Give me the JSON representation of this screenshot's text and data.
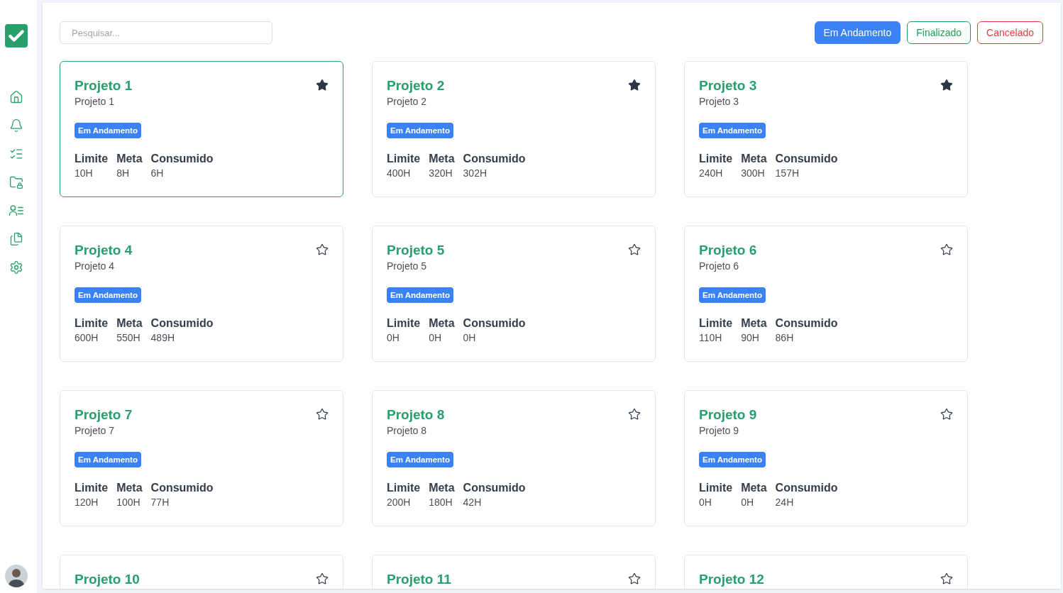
{
  "search": {
    "placeholder": "Pesquisar..."
  },
  "filters": [
    {
      "label": "Em Andamento",
      "kind": "progress",
      "selected": true
    },
    {
      "label": "Finalizado",
      "kind": "done",
      "selected": false
    },
    {
      "label": "Cancelado",
      "kind": "cancelled",
      "selected": false
    }
  ],
  "projects": [
    {
      "title": "Projeto 1",
      "subtitle": "Projeto 1",
      "status": "Em Andamento",
      "favorite": true,
      "selected": true,
      "stats": [
        {
          "label": "Limite",
          "value": "10H"
        },
        {
          "label": "Meta",
          "value": "8H"
        },
        {
          "label": "Consumido",
          "value": "6H"
        }
      ]
    },
    {
      "title": "Projeto 2",
      "subtitle": "Projeto 2",
      "status": "Em Andamento",
      "favorite": true,
      "selected": false,
      "stats": [
        {
          "label": "Limite",
          "value": "400H"
        },
        {
          "label": "Meta",
          "value": "320H"
        },
        {
          "label": "Consumido",
          "value": "302H"
        }
      ]
    },
    {
      "title": "Projeto 3",
      "subtitle": "Projeto 3",
      "status": "Em Andamento",
      "favorite": true,
      "selected": false,
      "stats": [
        {
          "label": "Limite",
          "value": "240H"
        },
        {
          "label": "Meta",
          "value": "300H"
        },
        {
          "label": "Consumido",
          "value": "157H"
        }
      ]
    },
    {
      "title": "Projeto 4",
      "subtitle": "Projeto 4",
      "status": "Em Andamento",
      "favorite": false,
      "selected": false,
      "stats": [
        {
          "label": "Limite",
          "value": "600H"
        },
        {
          "label": "Meta",
          "value": "550H"
        },
        {
          "label": "Consumido",
          "value": "489H"
        }
      ]
    },
    {
      "title": "Projeto 5",
      "subtitle": "Projeto 5",
      "status": "Em Andamento",
      "favorite": false,
      "selected": false,
      "stats": [
        {
          "label": "Limite",
          "value": "0H"
        },
        {
          "label": "Meta",
          "value": "0H"
        },
        {
          "label": "Consumido",
          "value": "0H"
        }
      ]
    },
    {
      "title": "Projeto 6",
      "subtitle": "Projeto 6",
      "status": "Em Andamento",
      "favorite": false,
      "selected": false,
      "stats": [
        {
          "label": "Limite",
          "value": "110H"
        },
        {
          "label": "Meta",
          "value": "90H"
        },
        {
          "label": "Consumido",
          "value": "86H"
        }
      ]
    },
    {
      "title": "Projeto 7",
      "subtitle": "Projeto 7",
      "status": "Em Andamento",
      "favorite": false,
      "selected": false,
      "stats": [
        {
          "label": "Limite",
          "value": "120H"
        },
        {
          "label": "Meta",
          "value": "100H"
        },
        {
          "label": "Consumido",
          "value": "77H"
        }
      ]
    },
    {
      "title": "Projeto 8",
      "subtitle": "Projeto 8",
      "status": "Em Andamento",
      "favorite": false,
      "selected": false,
      "stats": [
        {
          "label": "Limite",
          "value": "200H"
        },
        {
          "label": "Meta",
          "value": "180H"
        },
        {
          "label": "Consumido",
          "value": "42H"
        }
      ]
    },
    {
      "title": "Projeto 9",
      "subtitle": "Projeto 9",
      "status": "Em Andamento",
      "favorite": false,
      "selected": false,
      "stats": [
        {
          "label": "Limite",
          "value": "0H"
        },
        {
          "label": "Meta",
          "value": "0H"
        },
        {
          "label": "Consumido",
          "value": "24H"
        }
      ]
    },
    {
      "title": "Projeto 10",
      "favorite": false,
      "selected": false
    },
    {
      "title": "Projeto 11",
      "favorite": false,
      "selected": false
    },
    {
      "title": "Projeto 12",
      "favorite": false,
      "selected": false
    }
  ]
}
